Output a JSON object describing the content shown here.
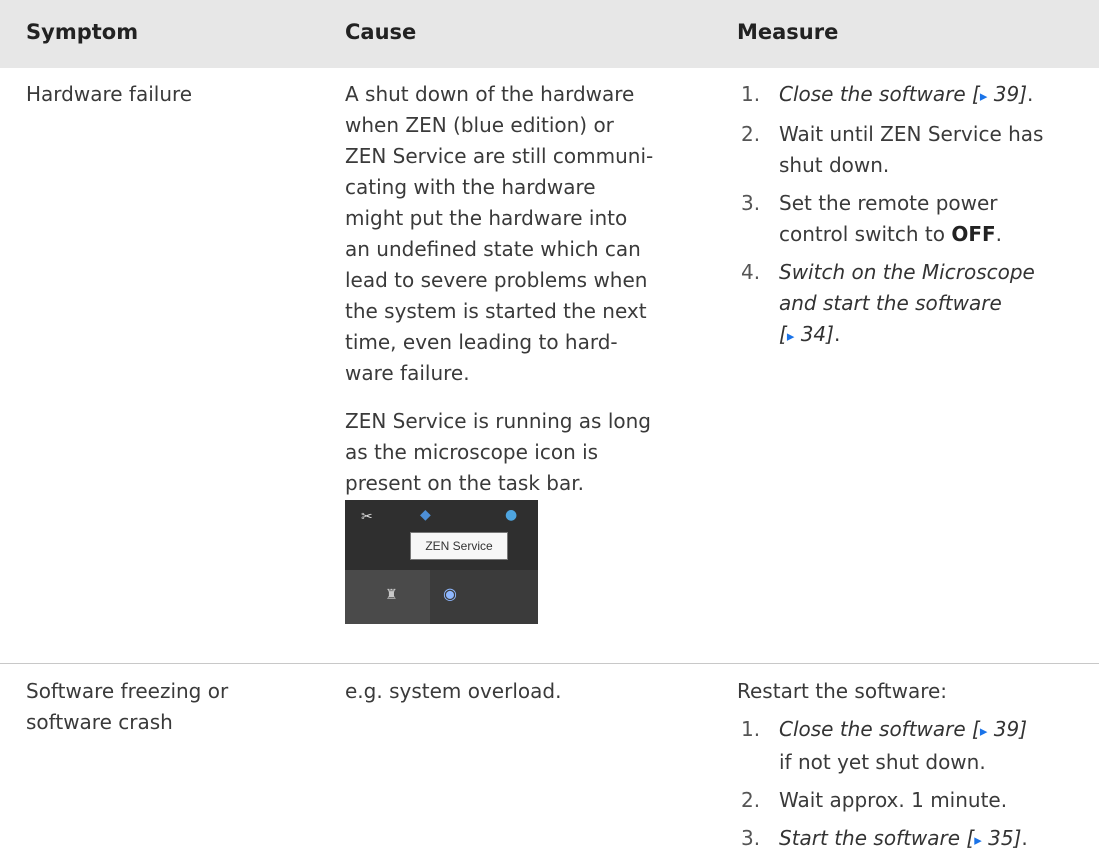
{
  "header": {
    "symptom": "Symptom",
    "cause": "Cause",
    "measure": "Measure"
  },
  "rows": [
    {
      "symptom": "Hardware failure",
      "cause_lines": [
        "A shut down of the hardware",
        "when ZEN (blue edition) or",
        "ZEN Service are still communi-",
        "cating with the hardware",
        "might put the hardware into",
        "an undefined state which can",
        "lead to severe problems when",
        "the system is started the next",
        "time, even leading to hard-",
        "ware failure."
      ],
      "cause_note_lines": [
        "ZEN Service is running as long",
        "as the microscope icon is",
        "present on the task bar."
      ],
      "screenshot": {
        "tooltip": "ZEN Service"
      },
      "steps": [
        {
          "num": "1.",
          "ref_text": "Close the software [",
          "page": " 39]",
          "tail": "."
        },
        {
          "num": "2.",
          "line1": "Wait until ZEN Service has",
          "line2": "shut down."
        },
        {
          "num": "3.",
          "line1": "Set the remote power",
          "line2_pre": "control switch to ",
          "bold": "OFF",
          "line2_post": "."
        },
        {
          "num": "4.",
          "line1": "Switch on the Microscope",
          "line2": "and start the software",
          "line3_pre": "[",
          "page": " 34]",
          "tail": "."
        }
      ]
    },
    {
      "symptom_lines": [
        "Software freezing or",
        "software crash"
      ],
      "cause": "e.g. system overload.",
      "intro": "Restart the software:",
      "steps": [
        {
          "num": "1.",
          "ref_text": "Close the software [",
          "page": " 39]",
          "line2": "if not yet shut down."
        },
        {
          "num": "2.",
          "text": "Wait approx. 1 minute."
        },
        {
          "num": "3.",
          "ref_text": "Start the software [",
          "page": " 35]",
          "tail": "."
        }
      ]
    }
  ],
  "icons": {
    "arrow": "▸"
  }
}
